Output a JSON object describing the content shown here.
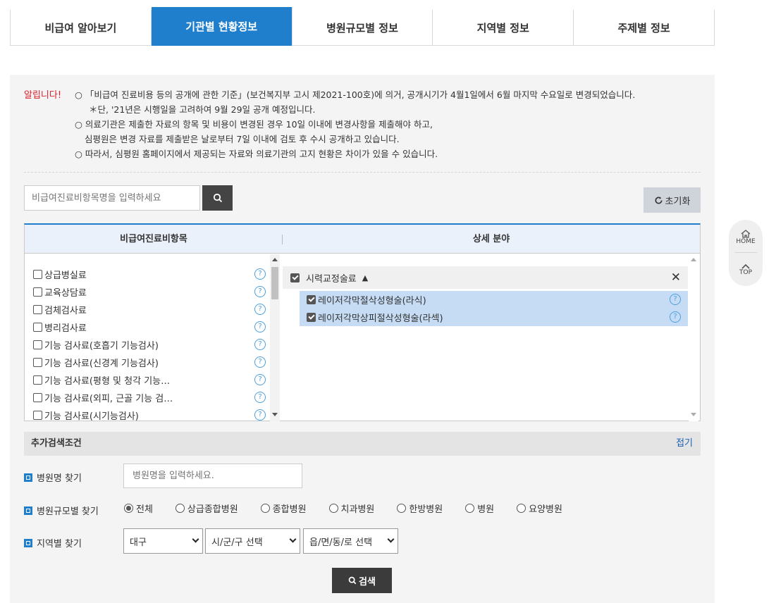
{
  "tabs": [
    "비급여 알아보기",
    "기관별 현황정보",
    "병원규모별 정보",
    "지역별 정보",
    "주제별 정보"
  ],
  "active_tab": 1,
  "notice": {
    "label": "알립니다!",
    "lines": [
      "○ 「비급여 진료비용 등의 공개에 관한 기준」(보건복지부 고시 제2021-100호)에 의거, 공개시기가 4월1일에서 6월 마지막 수요일로 변경되었습니다.",
      "    ＊단, '21년은 시행일을 고려하여 9월 29일 공개 예정입니다.",
      "○ 의료기관은 제출한 자료의 항목 및 비용이 변경된 경우 10일 이내에 변경사항을 제출해야 하고,",
      "   심평원은 변경 자료를 제출받은 날로부터 7일 이내에 검토 후 수시 공개하고 있습니다.",
      "○ 따라서, 심평원 홈페이지에서 제공되는 자료와 의료기관의 고지 현황은 차이가 있을 수 있습니다."
    ]
  },
  "search": {
    "placeholder": "비급여진료비항목명을 입력하세요",
    "reset_label": "초기화"
  },
  "selector": {
    "left_header": "비급여진료비항목",
    "right_header": "상세 분야",
    "items": [
      "상급병실료",
      "교육상담료",
      "검체검사료",
      "병리검사료",
      "기능 검사료(호흡기 기능검사)",
      "기능 검사료(신경계 기능검사)",
      "기능 검사료(평형 및 청각 기능…",
      "기능 검사료(외피, 근골 기능 검…",
      "기능 검사료(시기능검사)"
    ],
    "help_glyph": "?",
    "group": {
      "label": "시력교정술료",
      "close": "✕",
      "subs": [
        "레이저각막절삭성형술(라식)",
        "레이저각막상피절삭성형술(라섹)"
      ]
    }
  },
  "extra": {
    "title": "추가검색조건",
    "fold_label": "접기",
    "hospital_name_label": "병원명 찾기",
    "hospital_name_placeholder": "병원명을 입력하세요.",
    "scale_label": "병원규모별 찾기",
    "scale_options": [
      "전체",
      "상급종합병원",
      "종합병원",
      "치과병원",
      "한방병원",
      "병원",
      "요양병원"
    ],
    "scale_selected": 0,
    "region_label": "지역별 찾기",
    "region_selects": [
      "대구",
      "시/군/구 선택",
      "읍/면/동/로 선택"
    ],
    "search_label": "검색"
  },
  "side": {
    "home_label": "HOME",
    "top_label": "TOP"
  },
  "colors": {
    "accent": "#1f7fcc",
    "alert": "#d9202a",
    "selected_row": "#c6dcf5"
  }
}
